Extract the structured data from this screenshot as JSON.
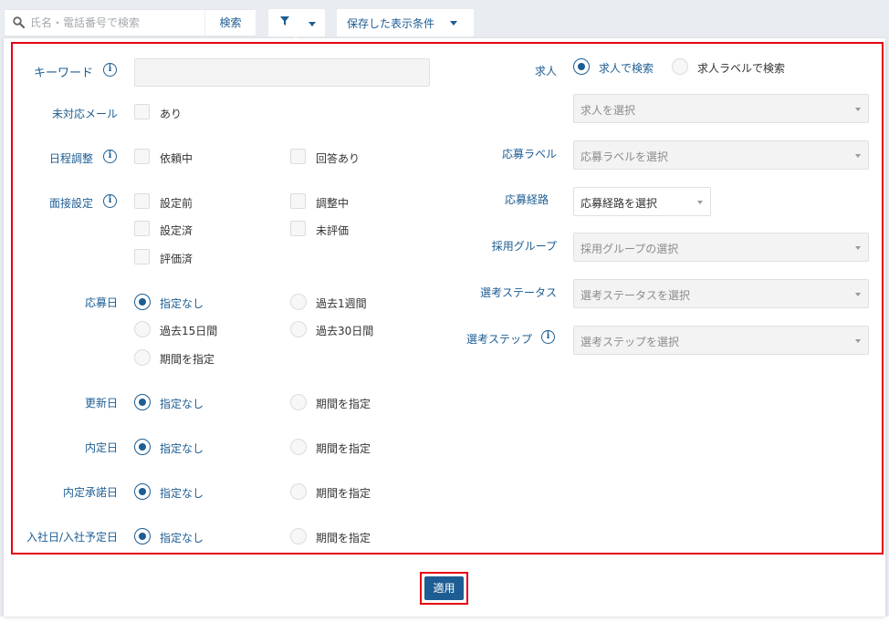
{
  "search": {
    "placeholder": "氏名・電話番号で検索",
    "button_label": "検索"
  },
  "saved_views": {
    "label": "保存した表示条件"
  },
  "filters": {
    "keyword": {
      "label": "キーワード",
      "value": ""
    },
    "unanswered_mail": {
      "label": "未対応メール",
      "options": [
        "あり"
      ]
    },
    "schedule": {
      "label": "日程調整",
      "options": [
        "依頼中",
        "回答あり"
      ]
    },
    "interview": {
      "label": "面接設定",
      "options": [
        "設定前",
        "調整中",
        "設定済",
        "未評価",
        "評価済"
      ]
    },
    "apply_date": {
      "label": "応募日",
      "options": [
        "指定なし",
        "過去1週間",
        "過去15日間",
        "過去30日間",
        "期間を指定"
      ],
      "selected": "指定なし"
    },
    "update_date": {
      "label": "更新日",
      "options": [
        "指定なし",
        "期間を指定"
      ],
      "selected": "指定なし"
    },
    "offer_date": {
      "label": "内定日",
      "options": [
        "指定なし",
        "期間を指定"
      ],
      "selected": "指定なし"
    },
    "offer_accept_date": {
      "label": "内定承諾日",
      "options": [
        "指定なし",
        "期間を指定"
      ],
      "selected": "指定なし"
    },
    "join_date": {
      "label": "入社日/入社予定日",
      "options": [
        "指定なし",
        "期間を指定"
      ],
      "selected": "指定なし"
    },
    "job": {
      "label": "求人",
      "options": [
        "求人で検索",
        "求人ラベルで検索"
      ],
      "selected": "求人で検索",
      "select_placeholder": "求人を選択"
    },
    "apply_label": {
      "label": "応募ラベル",
      "placeholder": "応募ラベルを選択"
    },
    "apply_route": {
      "label": "応募経路",
      "placeholder": "応募経路を選択"
    },
    "hiring_group": {
      "label": "採用グループ",
      "placeholder": "採用グループの選択"
    },
    "selection_status": {
      "label": "選考ステータス",
      "placeholder": "選考ステータスを選択"
    },
    "selection_step": {
      "label": "選考ステップ",
      "placeholder": "選考ステップを選択"
    }
  },
  "apply_button": {
    "label": "適用"
  },
  "colors": {
    "accent": "#1d5d93",
    "highlight": "#e4000f"
  }
}
